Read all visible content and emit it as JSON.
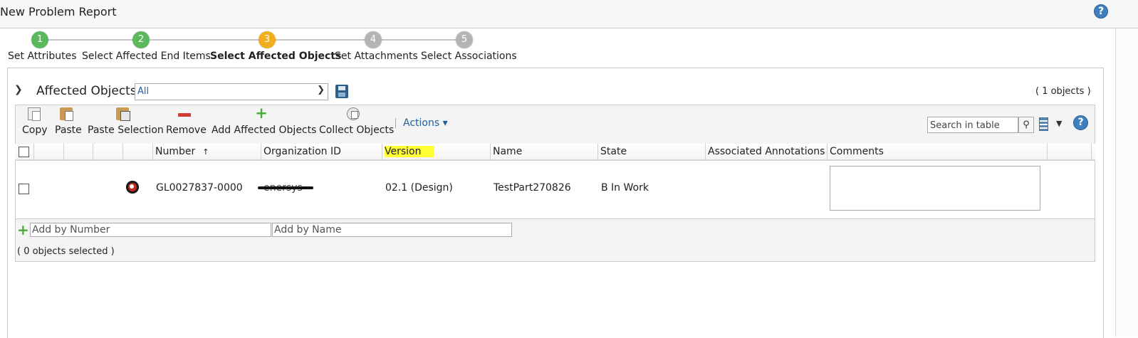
{
  "window": {
    "title": "New Problem Report",
    "help": "?"
  },
  "wizard": {
    "steps": [
      {
        "number": "1",
        "label": "Set Attributes",
        "status": "complete",
        "color": "#5cb85c"
      },
      {
        "number": "2",
        "label": "Select Affected End Items",
        "status": "complete",
        "color": "#5cb85c"
      },
      {
        "number": "3",
        "label": "Select Affected Objects",
        "status": "active",
        "color": "#f0ad1e"
      },
      {
        "number": "4",
        "label": "Set Attachments",
        "status": "pending",
        "color": "#b4b4b4"
      },
      {
        "number": "5",
        "label": "Select Associations",
        "status": "pending",
        "color": "#b4b4b4"
      }
    ]
  },
  "section": {
    "title": "Affected Objects",
    "view_value": "All",
    "count": "( 1 objects )"
  },
  "toolbar": {
    "buttons": [
      {
        "label": "Copy",
        "icon": "copy-icon"
      },
      {
        "label": "Paste",
        "icon": "paste-icon"
      },
      {
        "label": "Paste Selection",
        "icon": "paste-selection-icon"
      },
      {
        "label": "Remove",
        "icon": "remove-icon"
      },
      {
        "label": "Add Affected Objects",
        "icon": "add-icon"
      },
      {
        "label": "Collect Objects",
        "icon": "collect-icon"
      }
    ],
    "actions_label": "Actions ▾",
    "search_placeholder": "Search in table",
    "help": "?"
  },
  "table": {
    "columns": [
      "Number",
      "Organization ID",
      "Version",
      "Name",
      "State",
      "Associated Annotations",
      "Comments"
    ],
    "sort_indicator": "↑",
    "rows": [
      {
        "number": "GL0027837-0000",
        "organization_id": "enersys",
        "version": "02.1 (Design)",
        "name": "TestPart270826",
        "state": "B In Work",
        "associated_annotations": "",
        "comments": ""
      }
    ]
  },
  "add_row": {
    "number_placeholder": "Add by Number",
    "name_placeholder": "Add by Name"
  },
  "selection": {
    "count_text": "( 0 objects selected )"
  },
  "colors": {
    "link_blue": "#1f5f9f",
    "highlight_yellow": "#ffff33",
    "add_green": "#4caa3a",
    "remove_red": "#d23b2f"
  }
}
